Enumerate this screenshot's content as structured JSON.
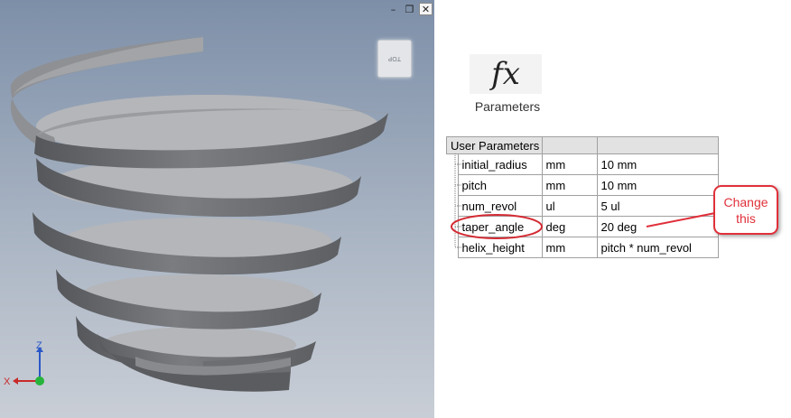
{
  "viewport": {
    "viewcube_label": "TOP",
    "triad": {
      "x_label": "X",
      "z_label": "Z"
    },
    "window_controls": [
      "–",
      "❐",
      "✕"
    ],
    "model_color": "#6d6f73"
  },
  "parameters_panel": {
    "icon_symbol": "fx",
    "icon_label": "Parameters",
    "header": "User Parameters",
    "rows": [
      {
        "name": "initial_radius",
        "unit": "mm",
        "equation": "10 mm"
      },
      {
        "name": "pitch",
        "unit": "mm",
        "equation": "10 mm"
      },
      {
        "name": "num_revol",
        "unit": "ul",
        "equation": "5 ul"
      },
      {
        "name": "taper_angle",
        "unit": "deg",
        "equation": "20 deg"
      },
      {
        "name": "helix_height",
        "unit": "mm",
        "equation": "pitch * num_revol"
      }
    ]
  },
  "annotation": {
    "callout_text": "Change\nthis",
    "color": "#e0303a"
  }
}
